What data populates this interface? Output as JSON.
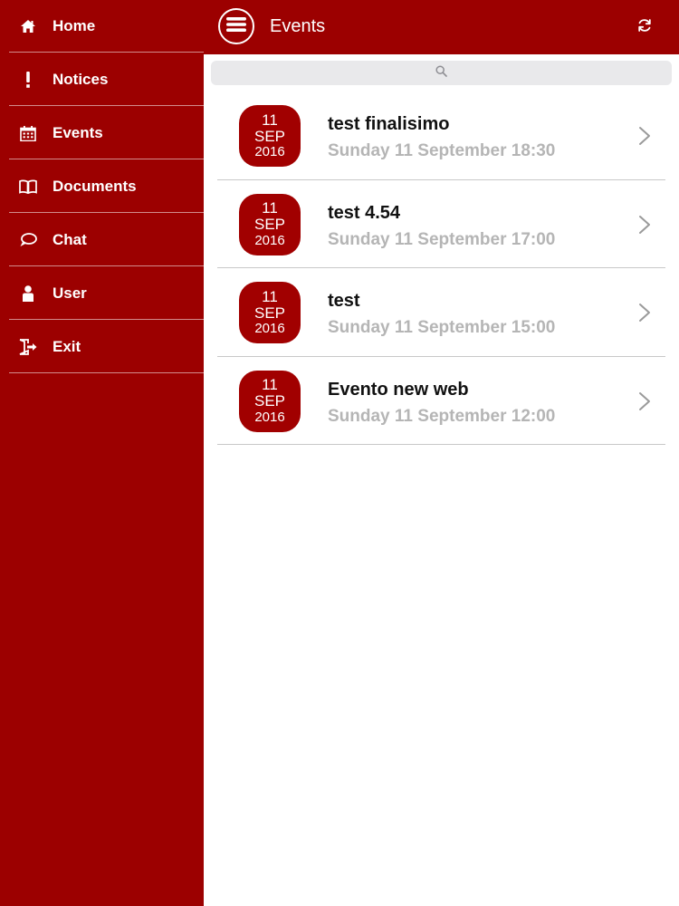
{
  "sidebar": {
    "items": [
      {
        "label": "Home",
        "icon": "home-icon"
      },
      {
        "label": "Notices",
        "icon": "exclamation-icon"
      },
      {
        "label": "Events",
        "icon": "calendar-icon"
      },
      {
        "label": "Documents",
        "icon": "book-icon"
      },
      {
        "label": "Chat",
        "icon": "chat-bubble-icon"
      },
      {
        "label": "User",
        "icon": "user-icon"
      },
      {
        "label": "Exit",
        "icon": "exit-icon"
      }
    ]
  },
  "header": {
    "title": "Events",
    "menu_icon": "hamburger-icon",
    "refresh_icon": "refresh-icon"
  },
  "search": {
    "placeholder": "",
    "icon": "search-icon"
  },
  "events": [
    {
      "day": "11",
      "month": "SEP",
      "year": "2016",
      "title": "test finalisimo",
      "when": "Sunday 11 September 18:30"
    },
    {
      "day": "11",
      "month": "SEP",
      "year": "2016",
      "title": "test 4.54",
      "when": "Sunday 11 September 17:00"
    },
    {
      "day": "11",
      "month": "SEP",
      "year": "2016",
      "title": "test",
      "when": "Sunday 11 September 15:00"
    },
    {
      "day": "11",
      "month": "SEP",
      "year": "2016",
      "title": "Evento new web",
      "when": "Sunday 11 September 12:00"
    }
  ],
  "colors": {
    "brand": "#9c0000",
    "badge": "#a10000",
    "subtitle": "#b5b5b5"
  }
}
